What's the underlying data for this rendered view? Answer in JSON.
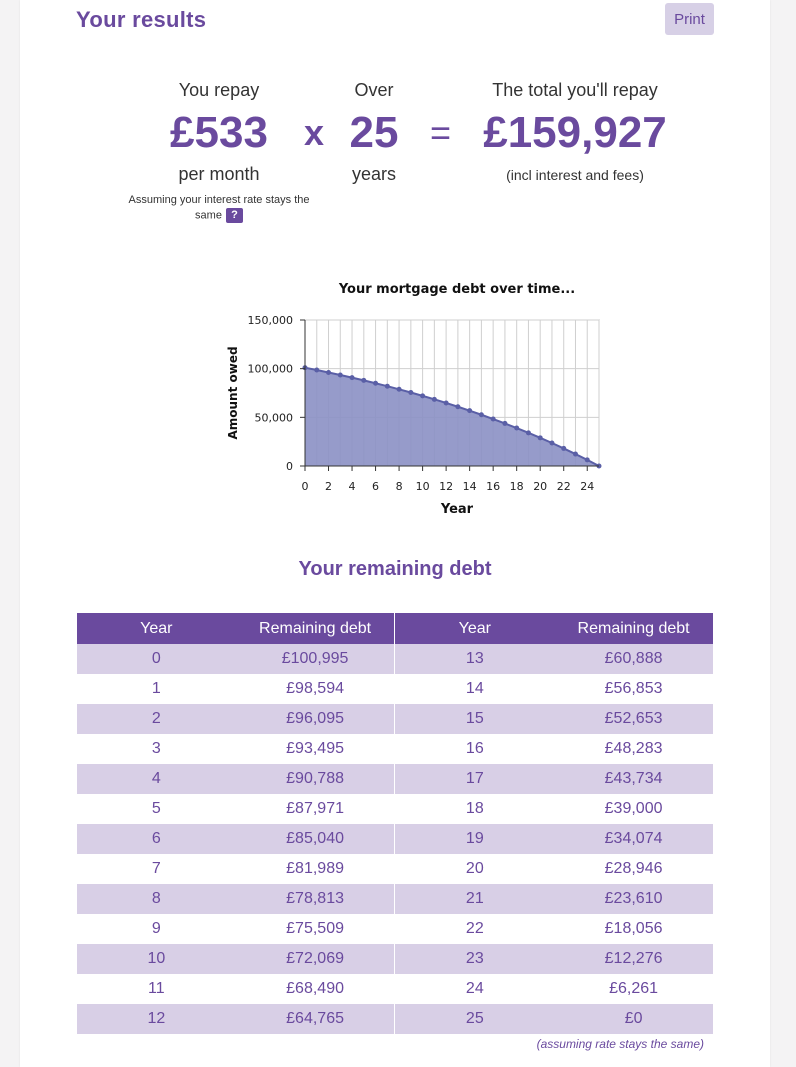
{
  "header": {
    "title": "Your results",
    "print_label": "Print"
  },
  "summary": {
    "repay_label": "You repay",
    "repay_value": "£533",
    "repay_unit": "per month",
    "multiply_symbol": "x",
    "over_label": "Over",
    "over_value": "25",
    "over_unit": "years",
    "equals_symbol": "=",
    "total_label": "The total you'll repay",
    "total_value": "£159,927",
    "total_unit": "(incl interest and fees)",
    "note": "Assuming your interest rate stays the same",
    "help_symbol": "?"
  },
  "chart_data": {
    "type": "area",
    "title": "Your mortgage debt over time...",
    "xlabel": "Year",
    "ylabel": "Amount owed",
    "x": [
      0,
      1,
      2,
      3,
      4,
      5,
      6,
      7,
      8,
      9,
      10,
      11,
      12,
      13,
      14,
      15,
      16,
      17,
      18,
      19,
      20,
      21,
      22,
      23,
      24,
      25
    ],
    "values": [
      100995,
      98594,
      96095,
      93495,
      90788,
      87971,
      85040,
      81989,
      78813,
      75509,
      72069,
      68490,
      64765,
      60888,
      56853,
      52653,
      48283,
      43734,
      39000,
      34074,
      28946,
      23610,
      18056,
      12276,
      6261,
      0
    ],
    "xlim": [
      0,
      25
    ],
    "ylim": [
      0,
      150000
    ],
    "xticks": [
      "0",
      "2",
      "4",
      "6",
      "8",
      "10",
      "12",
      "14",
      "16",
      "18",
      "20",
      "22",
      "24"
    ],
    "yticks": [
      "0",
      "50,000",
      "100,000",
      "150,000"
    ],
    "grid": true,
    "colors": {
      "fill": "#8b90c4",
      "line": "#5a5fa6"
    }
  },
  "table": {
    "title": "Your remaining debt",
    "headers": [
      "Year",
      "Remaining debt",
      "Year",
      "Remaining debt"
    ],
    "rows": [
      [
        "0",
        "£100,995",
        "13",
        "£60,888"
      ],
      [
        "1",
        "£98,594",
        "14",
        "£56,853"
      ],
      [
        "2",
        "£96,095",
        "15",
        "£52,653"
      ],
      [
        "3",
        "£93,495",
        "16",
        "£48,283"
      ],
      [
        "4",
        "£90,788",
        "17",
        "£43,734"
      ],
      [
        "5",
        "£87,971",
        "18",
        "£39,000"
      ],
      [
        "6",
        "£85,040",
        "19",
        "£34,074"
      ],
      [
        "7",
        "£81,989",
        "20",
        "£28,946"
      ],
      [
        "8",
        "£78,813",
        "21",
        "£23,610"
      ],
      [
        "9",
        "£75,509",
        "22",
        "£18,056"
      ],
      [
        "10",
        "£72,069",
        "23",
        "£12,276"
      ],
      [
        "11",
        "£68,490",
        "24",
        "£6,261"
      ],
      [
        "12",
        "£64,765",
        "25",
        "£0"
      ]
    ],
    "footnote": "(assuming rate stays the same)"
  },
  "colors": {
    "brand": "#6a4a9e",
    "row_alt": "#d8cfe6",
    "print_bg": "#d7d0e6"
  }
}
